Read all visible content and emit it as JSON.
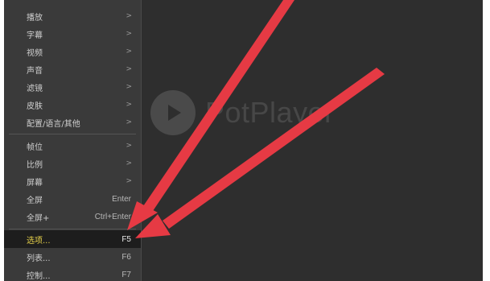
{
  "logo": {
    "text": "PotPlayer"
  },
  "menu": {
    "group1": [
      {
        "label": "播放",
        "arrow": ">"
      },
      {
        "label": "字幕",
        "arrow": ">"
      },
      {
        "label": "视频",
        "arrow": ">"
      },
      {
        "label": "声音",
        "arrow": ">"
      },
      {
        "label": "滤镜",
        "arrow": ">"
      },
      {
        "label": "皮肤",
        "arrow": ">"
      },
      {
        "label": "配置/语言/其他",
        "arrow": ">"
      }
    ],
    "group2": [
      {
        "label": "帧位",
        "arrow": ">"
      },
      {
        "label": "比例",
        "arrow": ">"
      },
      {
        "label": "屏幕",
        "arrow": ">"
      },
      {
        "label": "全屏",
        "shortcut": "Enter"
      },
      {
        "label": "全屏+",
        "shortcut": "Ctrl+Enter"
      }
    ],
    "group3": [
      {
        "label": "选项...",
        "shortcut": "F5"
      },
      {
        "label": "列表...",
        "shortcut": "F6"
      },
      {
        "label": "控制...",
        "shortcut": "F7"
      }
    ]
  },
  "colors": {
    "arrow": "#e63a44",
    "selected_text": "#e8d24a",
    "menu_bg": "#3a3a3a",
    "player_bg": "#2e2e2e"
  }
}
